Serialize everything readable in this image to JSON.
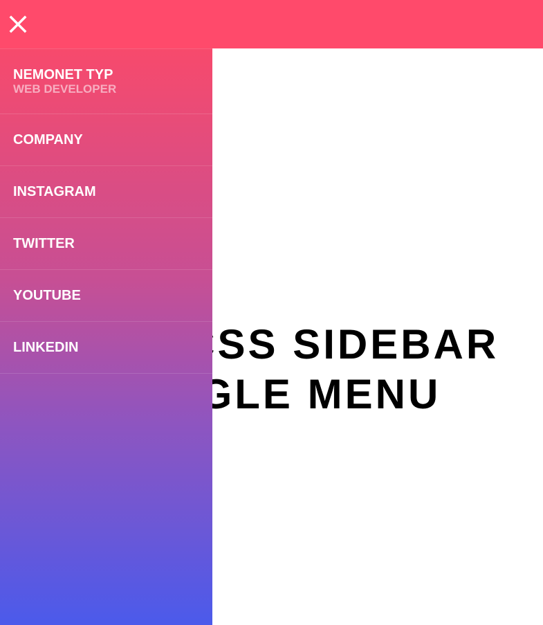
{
  "header": {
    "close_icon": "close-icon"
  },
  "hero": {
    "line1": "PURE CSS SIDEBAR",
    "line2": "TOGGLE MENU"
  },
  "sidebar": {
    "profile": {
      "name": "NEMONET TYP",
      "role": "WEB DEVELOPER"
    },
    "items": [
      {
        "label": "COMPANY"
      },
      {
        "label": "INSTAGRAM"
      },
      {
        "label": "TWITTER"
      },
      {
        "label": "YOUTUBE"
      },
      {
        "label": "LINKEDIN"
      }
    ]
  },
  "colors": {
    "topbar": "#ff4a6b",
    "gradient_top": "#f74a6c",
    "gradient_bottom": "#4b5aeb",
    "text": "#ffffff"
  }
}
